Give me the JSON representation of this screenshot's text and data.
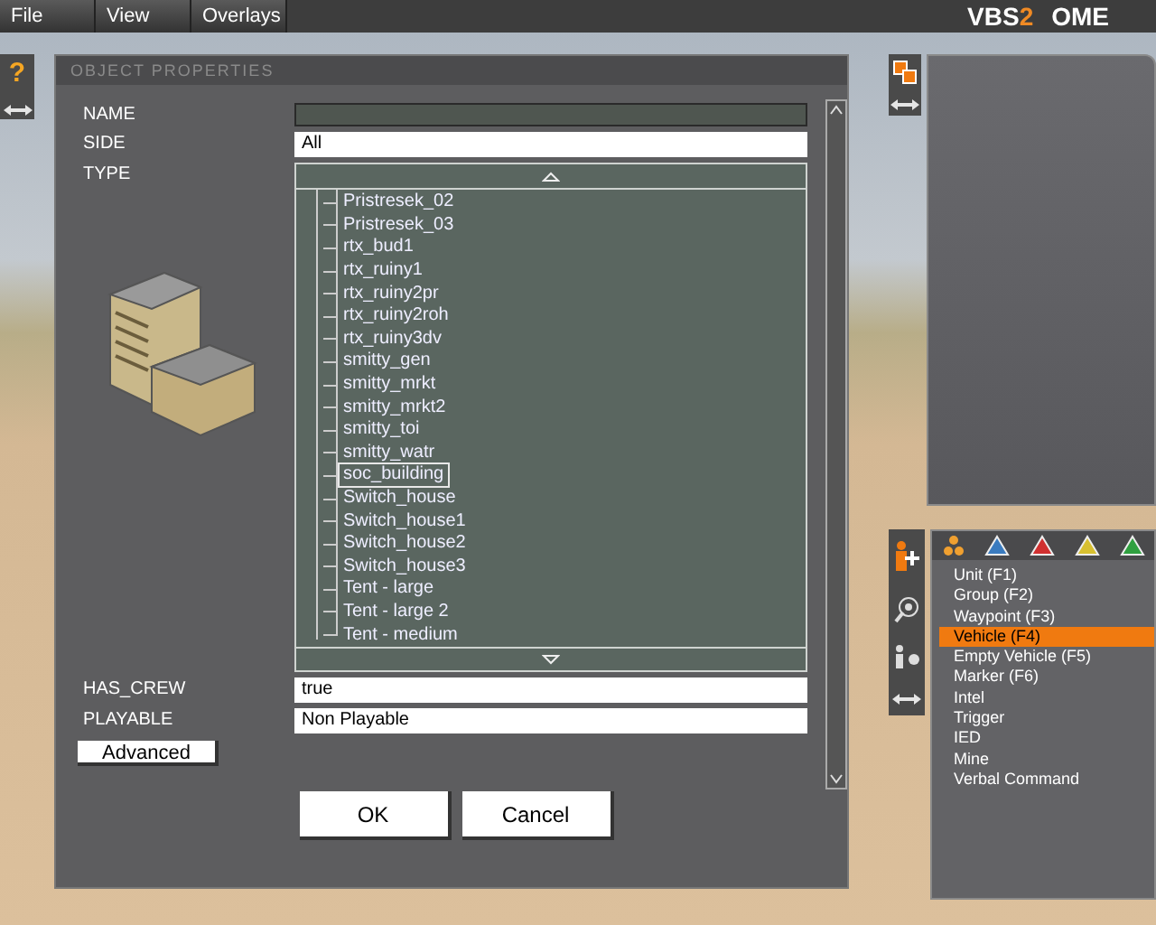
{
  "menu": [
    {
      "label": "File"
    },
    {
      "label": "View"
    },
    {
      "label": "Overlays"
    }
  ],
  "logo": {
    "brand": "VBS",
    "version": "2",
    "suffix": "OME"
  },
  "help_glyph": "?",
  "dialog": {
    "title": "OBJECT PROPERTIES",
    "name": {
      "label": "NAME"
    },
    "side": {
      "label": "SIDE",
      "value": "All"
    },
    "type": {
      "label": "TYPE",
      "items": [
        {
          "label": "Pristresek_02",
          "selected": false
        },
        {
          "label": "Pristresek_03",
          "selected": false
        },
        {
          "label": "rtx_bud1",
          "selected": false
        },
        {
          "label": "rtx_ruiny1",
          "selected": false
        },
        {
          "label": "rtx_ruiny2pr",
          "selected": false
        },
        {
          "label": "rtx_ruiny2roh",
          "selected": false
        },
        {
          "label": "rtx_ruiny3dv",
          "selected": false
        },
        {
          "label": "smitty_gen",
          "selected": false
        },
        {
          "label": "smitty_mrkt",
          "selected": false
        },
        {
          "label": "smitty_mrkt2",
          "selected": false
        },
        {
          "label": "smitty_toi",
          "selected": false
        },
        {
          "label": "smitty_watr",
          "selected": false
        },
        {
          "label": "soc_building",
          "selected": true
        },
        {
          "label": "Switch_house",
          "selected": false
        },
        {
          "label": "Switch_house1",
          "selected": false
        },
        {
          "label": "Switch_house2",
          "selected": false
        },
        {
          "label": "Switch_house3",
          "selected": false
        },
        {
          "label": "Tent - large",
          "selected": false
        },
        {
          "label": "Tent - large 2",
          "selected": false
        },
        {
          "label": "Tent - medium",
          "selected": false
        }
      ]
    },
    "has_crew": {
      "label": "HAS_CREW",
      "value": "true"
    },
    "playable": {
      "label": "PLAYABLE",
      "value": "Non Playable"
    },
    "advanced_button": "Advanced",
    "buttons": [
      "OK",
      "Cancel"
    ]
  },
  "insert_menu": {
    "items": [
      {
        "label": "Unit (F1)",
        "selected": false
      },
      {
        "label": "Group (F2)",
        "selected": false
      },
      {
        "label": "Waypoint (F3)",
        "selected": false
      },
      {
        "label": "Vehicle (F4)",
        "selected": true
      },
      {
        "label": "Empty Vehicle (F5)",
        "selected": false
      },
      {
        "label": "Marker (F6)",
        "selected": false
      },
      {
        "label": "Intel",
        "selected": false
      },
      {
        "label": "Trigger",
        "selected": false
      },
      {
        "label": "IED",
        "selected": false
      },
      {
        "label": "Mine",
        "selected": false
      },
      {
        "label": "Verbal Command",
        "selected": false
      }
    ]
  }
}
